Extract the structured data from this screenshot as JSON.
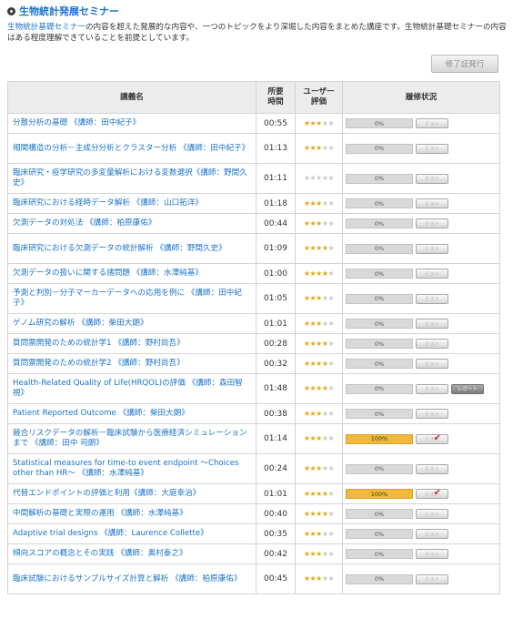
{
  "page": {
    "title": "生物統計発展セミナー",
    "desc_lead": "生物統計基礎セミナー",
    "desc_rest": "の内容を超えた発展的な内容や、一つのトピックをより深堀した内容をまとめた講座です。生物統計基礎セミナーの内容はある程度理解できていることを前提としています。",
    "cert_button": "修了証発行"
  },
  "table": {
    "headers": {
      "name": "講義名",
      "time": "所要\n時間",
      "rating": "ユーザー\n評価",
      "status": "履修状況"
    },
    "rows": [
      {
        "name": "分散分析の基礎 《講師：田中紀子》",
        "time": "00:55",
        "stars": 3,
        "progress": "0%",
        "done": false,
        "button": "テスト"
      },
      {
        "name": "相関構造の分析－主成分分析とクラスター分析 《講師：田中紀子》",
        "time": "01:13",
        "stars": 3,
        "progress": "0%",
        "done": false,
        "button": "テスト"
      },
      {
        "name": "臨床研究・疫学研究の多変量解析における変数選択《講師：野間久史》",
        "time": "01:11",
        "stars": 0,
        "progress": "0%",
        "done": false,
        "button": "テスト"
      },
      {
        "name": "臨床研究における経時データ解析 《講師：山口拓洋》",
        "time": "01:18",
        "stars": 3,
        "progress": "0%",
        "done": false,
        "button": "テスト"
      },
      {
        "name": "欠測データの対処法 《講師：柏原康佑》",
        "time": "00:44",
        "stars": 3,
        "progress": "0%",
        "done": false,
        "button": "テスト"
      },
      {
        "name": "臨床研究における欠測データの統計解析 《講師：野間久史》",
        "time": "01:09",
        "stars": 4,
        "progress": "0%",
        "done": false,
        "button": "テスト"
      },
      {
        "name": "欠測データの扱いに関する諸問題 《講師：水澤純基》",
        "time": "01:00",
        "stars": 4,
        "progress": "0%",
        "done": false,
        "button": "テスト"
      },
      {
        "name": "予測と判別－分子マーカーデータへの応用を例に 《講師：田中紀子》",
        "time": "01:05",
        "stars": 3,
        "progress": "0%",
        "done": false,
        "button": "テスト"
      },
      {
        "name": "ゲノム研究の解析 《講師：柴田大朗》",
        "time": "01:01",
        "stars": 3,
        "progress": "0%",
        "done": false,
        "button": "テスト"
      },
      {
        "name": "質問票開発のための統計学1 《講師：野村尚吾》",
        "time": "00:28",
        "stars": 4,
        "progress": "0%",
        "done": false,
        "button": "テスト"
      },
      {
        "name": "質問票開発のための統計学2 《講師：野村尚吾》",
        "time": "00:32",
        "stars": 4,
        "progress": "0%",
        "done": false,
        "button": "テスト"
      },
      {
        "name": "Health-Related Quality of Life(HRQOL)の評価 《講師：森田智視》",
        "time": "01:48",
        "stars": 4,
        "progress": "0%",
        "done": false,
        "button": "テスト",
        "extra_button": "レポート"
      },
      {
        "name": "Patient Reported Outcome 《講師：柴田大朗》",
        "time": "00:38",
        "stars": 3,
        "progress": "0%",
        "done": false,
        "button": "テスト"
      },
      {
        "name": "競合リスクデータの解析－臨床試験から医療経済シミュレーションまで 《講師：田中 司朗》",
        "time": "01:14",
        "stars": 3,
        "progress": "100%",
        "done": true,
        "button": "テスト"
      },
      {
        "name": "Statistical measures for time-to event endpoint ～Choices other than HR～ 《講師：水澤純基》",
        "time": "00:24",
        "stars": 3,
        "progress": "0%",
        "done": false,
        "button": "テスト"
      },
      {
        "name": "代替エンドポイントの評価と利用《講師：大庭幸治》",
        "time": "01:01",
        "stars": 4,
        "progress": "100%",
        "done": true,
        "button": "テスト"
      },
      {
        "name": "中間解析の基礎と実際の運用 《講師：水澤純基》",
        "time": "00:40",
        "stars": 4,
        "progress": "0%",
        "done": false,
        "button": "テスト"
      },
      {
        "name": "Adaptive trial designs 《講師：Laurence Collette》",
        "time": "00:35",
        "stars": 3,
        "progress": "0%",
        "done": false,
        "button": "テスト"
      },
      {
        "name": "傾向スコアの概念とその実践 《講師：奥村泰之》",
        "time": "00:42",
        "stars": 3,
        "progress": "0%",
        "done": false,
        "button": "テスト"
      },
      {
        "name": "臨床試験におけるサンプルサイズ計算と解析 《講師：柏原康佑》",
        "time": "00:45",
        "stars": 3,
        "progress": "0%",
        "done": false,
        "button": "テスト"
      }
    ]
  },
  "colors": {
    "link": "#1a73c9",
    "progress_done": "#f0b93e",
    "progress_empty": "#d9d9d9",
    "star_on": "#e3a916",
    "star_off": "#c9c9c9",
    "check": "#d8262b"
  }
}
